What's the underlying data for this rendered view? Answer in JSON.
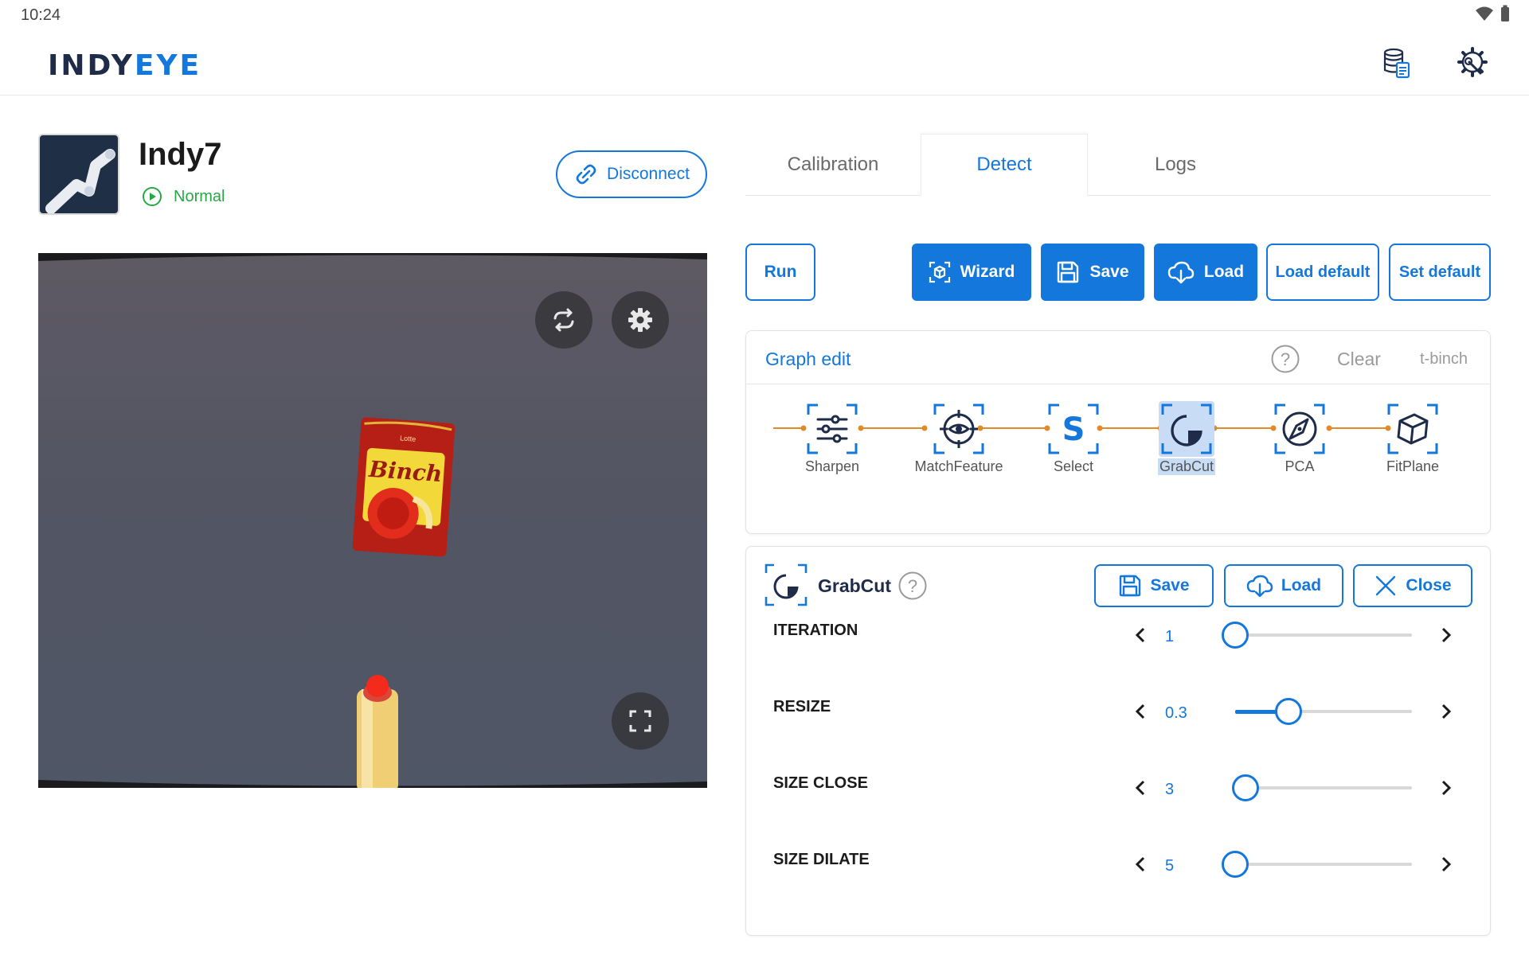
{
  "status_bar": {
    "time": "10:24"
  },
  "header": {
    "logo_part1": "INDY",
    "logo_part2": "EYE",
    "db_icon": "database-document-icon",
    "settings_icon": "gear-wrench-icon"
  },
  "robot": {
    "name": "Indy7",
    "status": "Normal",
    "disconnect_label": "Disconnect"
  },
  "camera": {
    "product_text": "Binch",
    "product_subtext": "Lotte",
    "refresh_icon": "refresh-icon",
    "settings_icon": "gear-icon",
    "fullscreen_icon": "fullscreen-icon"
  },
  "tabs": [
    {
      "label": "Calibration",
      "active": false
    },
    {
      "label": "Detect",
      "active": true
    },
    {
      "label": "Logs",
      "active": false
    }
  ],
  "toolbar": {
    "run": "Run",
    "wizard": "Wizard",
    "save": "Save",
    "load": "Load",
    "load_default": "Load default",
    "set_default": "Set default"
  },
  "graph": {
    "title": "Graph edit",
    "clear": "Clear",
    "preset": "t-binch",
    "nodes": [
      {
        "label": "Sharpen",
        "icon": "sliders-icon"
      },
      {
        "label": "MatchFeature",
        "icon": "eye-target-icon"
      },
      {
        "label": "Select",
        "icon": "select-s-icon"
      },
      {
        "label": "GrabCut",
        "icon": "grabcut-icon"
      },
      {
        "label": "PCA",
        "icon": "compass-icon"
      },
      {
        "label": "FitPlane",
        "icon": "cube-icon"
      }
    ],
    "selected": "GrabCut"
  },
  "panel": {
    "title": "GrabCut",
    "save": "Save",
    "load": "Load",
    "close": "Close",
    "params": [
      {
        "label": "ITERATION",
        "value": "1",
        "fraction": 0.0
      },
      {
        "label": "RESIZE",
        "value": "0.3",
        "fraction": 0.3
      },
      {
        "label": "SIZE CLOSE",
        "value": "3",
        "fraction": 0.06
      },
      {
        "label": "SIZE DILATE",
        "value": "5",
        "fraction": 0.0
      }
    ]
  },
  "colors": {
    "accent": "#1477dc",
    "status_ok": "#27a844",
    "graph_line": "#e08a2a"
  }
}
